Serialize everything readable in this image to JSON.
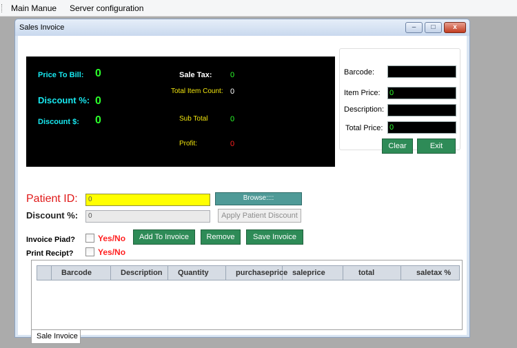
{
  "menu": {
    "main": "Main Manue",
    "server": "Server configuration"
  },
  "window": {
    "title": "Sales Invoice",
    "min": "–",
    "max": "□",
    "close": "x"
  },
  "display": {
    "price_to_bill_label": "Price To Bill:",
    "price_to_bill_value": "0",
    "discount_pct_label": "Discount %:",
    "discount_pct_value": "0",
    "discount_amt_label": "Discount $:",
    "discount_amt_value": "0",
    "sale_tax_label": "Sale Tax:",
    "sale_tax_value": "0",
    "total_item_count_label": "Total Item Count:",
    "total_item_count_value": "0",
    "sub_total_label": "Sub Total",
    "sub_total_value": "0",
    "profit_label": "Profit:",
    "profit_value": "0"
  },
  "item": {
    "barcode_label": "Barcode:",
    "barcode_value": "",
    "item_price_label": "Item Price:",
    "item_price_value": "0",
    "description_label": "Description:",
    "description_value": "",
    "total_price_label": "Total Price:",
    "total_price_value": "0",
    "clear": "Clear",
    "exit": "Exit"
  },
  "patient": {
    "id_label": "Patient ID:",
    "id_value": "0",
    "browse": "Browse::::",
    "discount_label": "Discount %:",
    "discount_value": "0",
    "apply": "Apply Patient Discount"
  },
  "invoice": {
    "paid_label": "Invoice Piad?",
    "paid_yesno": "Yes/No",
    "print_label": "Print Recipt?",
    "print_yesno": "Yes/No",
    "add": "Add To Invoice",
    "remove": "Remove",
    "save": "Save Invoice"
  },
  "grid": {
    "columns": [
      "Barcode",
      "Description",
      "Quantity",
      "purchaseprice",
      "saleprice",
      "total",
      "saletax %"
    ]
  },
  "tabs": {
    "sale_invoice": "Sale Invoice"
  }
}
